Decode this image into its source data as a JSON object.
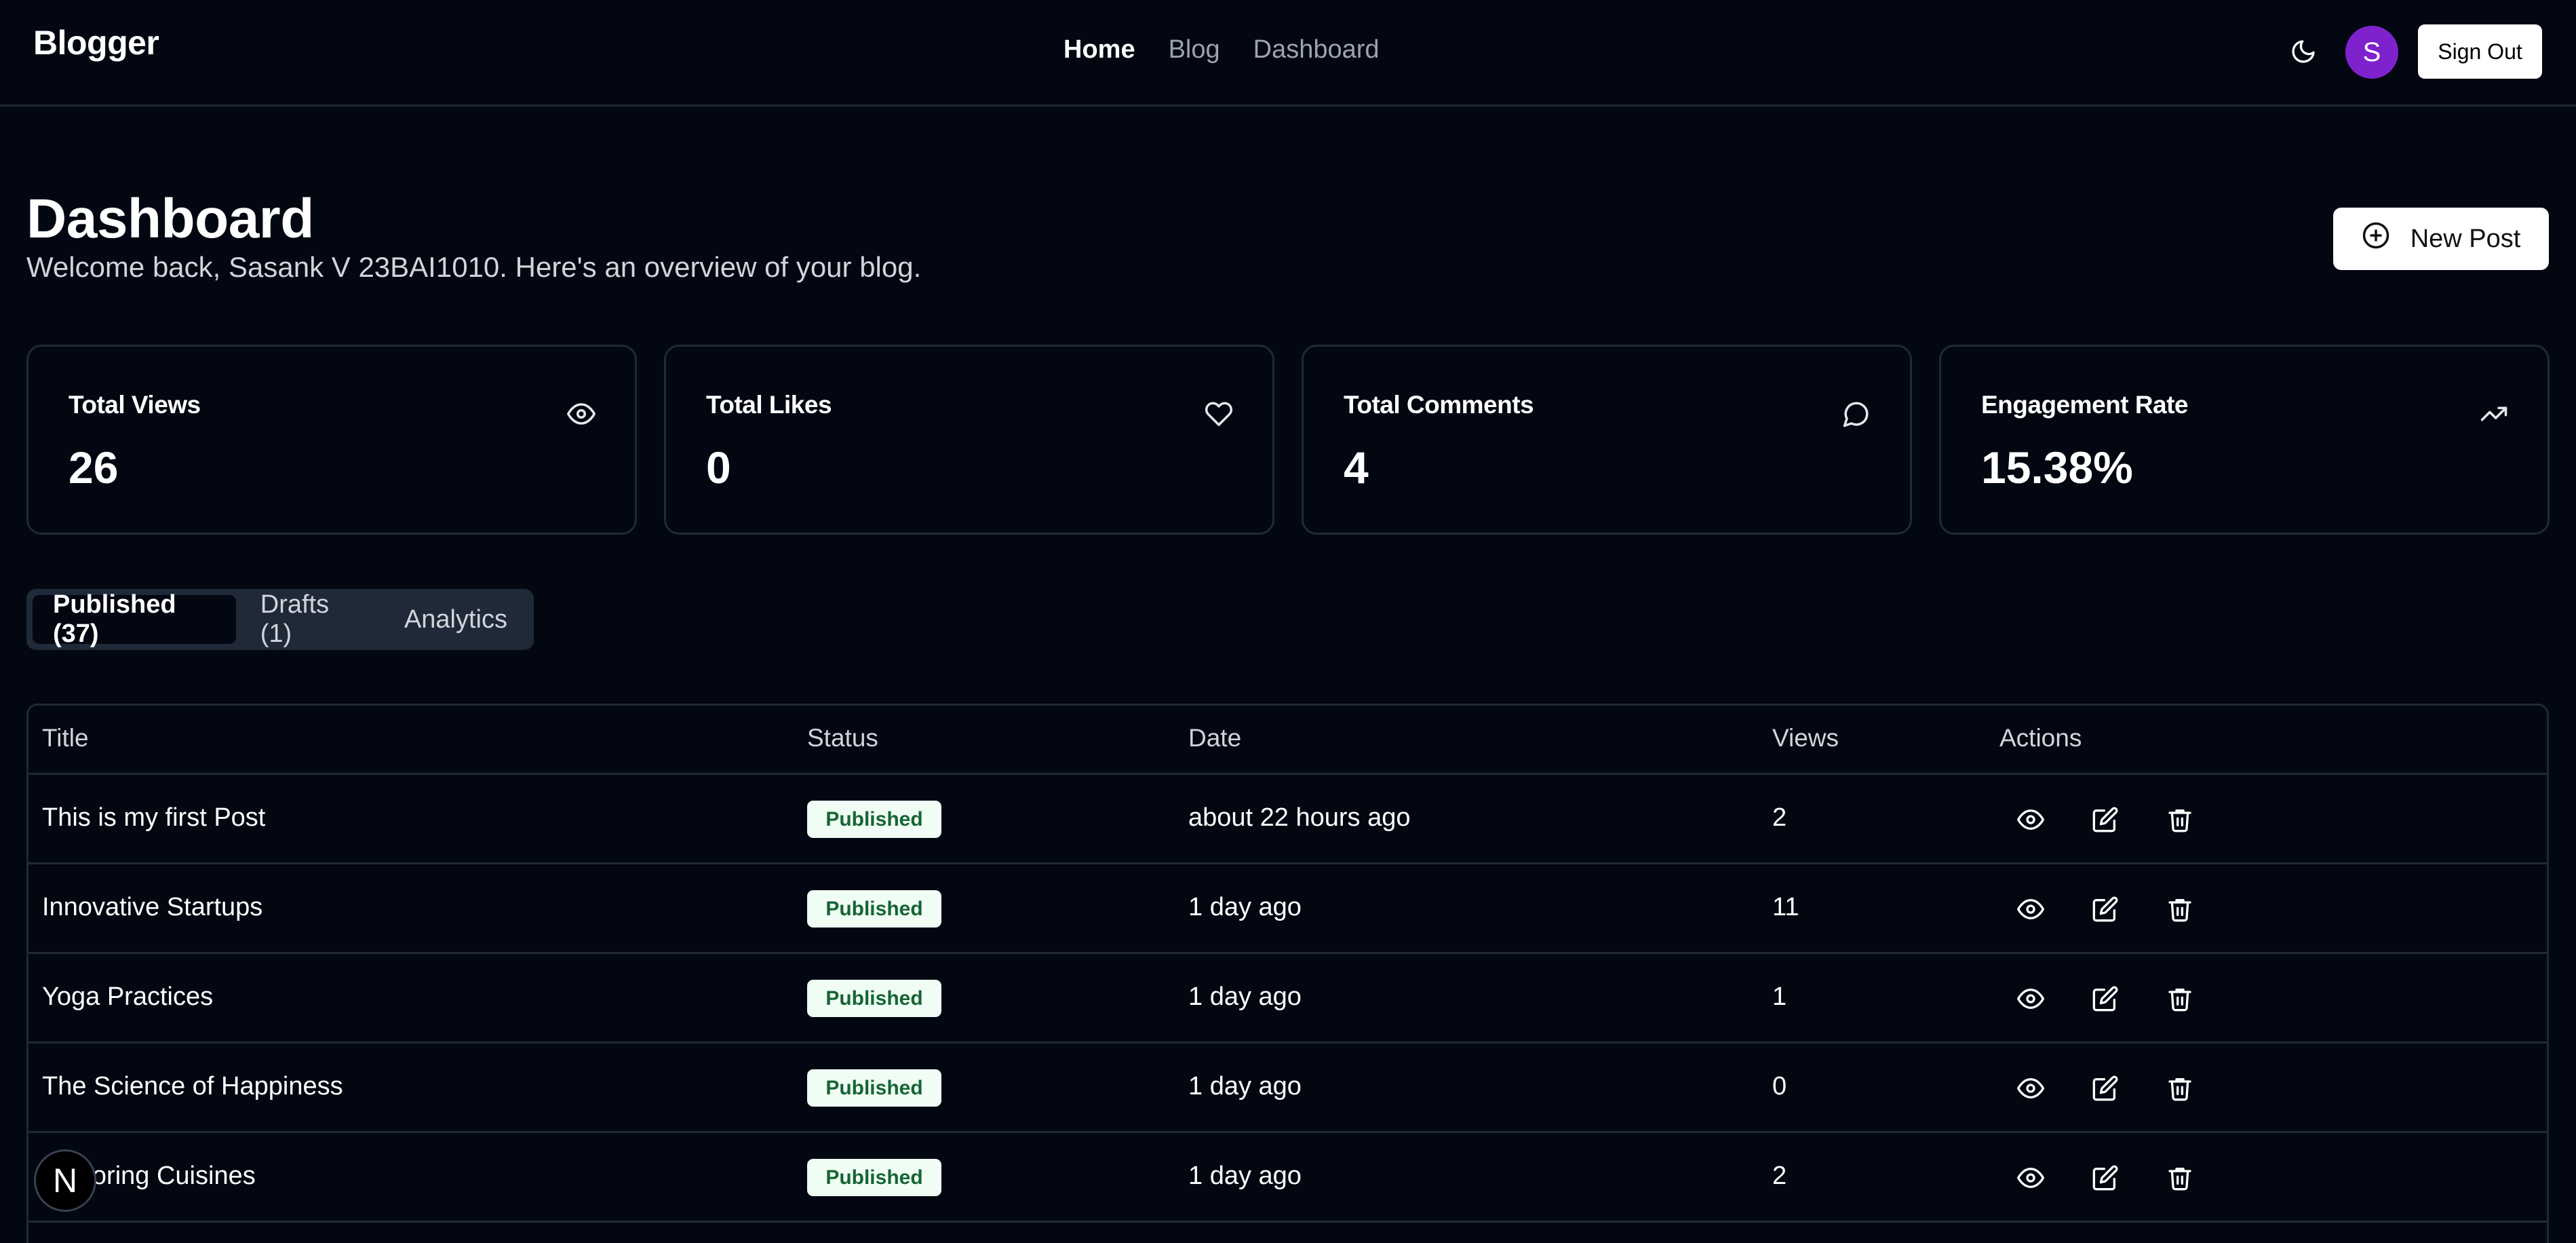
{
  "header": {
    "brand": "Blogger",
    "nav": [
      "Home",
      "Blog",
      "Dashboard"
    ],
    "active_nav": "Home",
    "avatar_initial": "S",
    "sign_out": "Sign Out",
    "theme_icon": "moon-icon"
  },
  "page": {
    "title": "Dashboard",
    "subtitle": "Welcome back, Sasank V 23BAI1010. Here's an overview of your blog.",
    "new_post": "New Post"
  },
  "stats": [
    {
      "label": "Total Views",
      "value": "26",
      "icon": "eye-icon"
    },
    {
      "label": "Total Likes",
      "value": "0",
      "icon": "heart-icon"
    },
    {
      "label": "Total Comments",
      "value": "4",
      "icon": "comment-icon"
    },
    {
      "label": "Engagement Rate",
      "value": "15.38%",
      "icon": "trending-up-icon"
    }
  ],
  "tabs": [
    "Published (37)",
    "Drafts (1)",
    "Analytics"
  ],
  "table": {
    "headers": [
      "Title",
      "Status",
      "Date",
      "Views",
      "Actions"
    ],
    "rows": [
      {
        "title": "This is my first Post",
        "status": "Published",
        "date": "about 22 hours ago",
        "views": "2"
      },
      {
        "title": "Innovative Startups",
        "status": "Published",
        "date": "1 day ago",
        "views": "11"
      },
      {
        "title": "Yoga Practices",
        "status": "Published",
        "date": "1 day ago",
        "views": "1"
      },
      {
        "title": "The Science of Happiness",
        "status": "Published",
        "date": "1 day ago",
        "views": "0"
      },
      {
        "title": "Exploring Cuisines",
        "status": "Published",
        "date": "1 day ago",
        "views": "2"
      }
    ]
  },
  "floating_badge": "N",
  "colors": {
    "background": "#030712",
    "border": "#1f2937",
    "avatar": "#7e22ce",
    "badge_bg": "#f0fdf4",
    "badge_text": "#166534"
  }
}
